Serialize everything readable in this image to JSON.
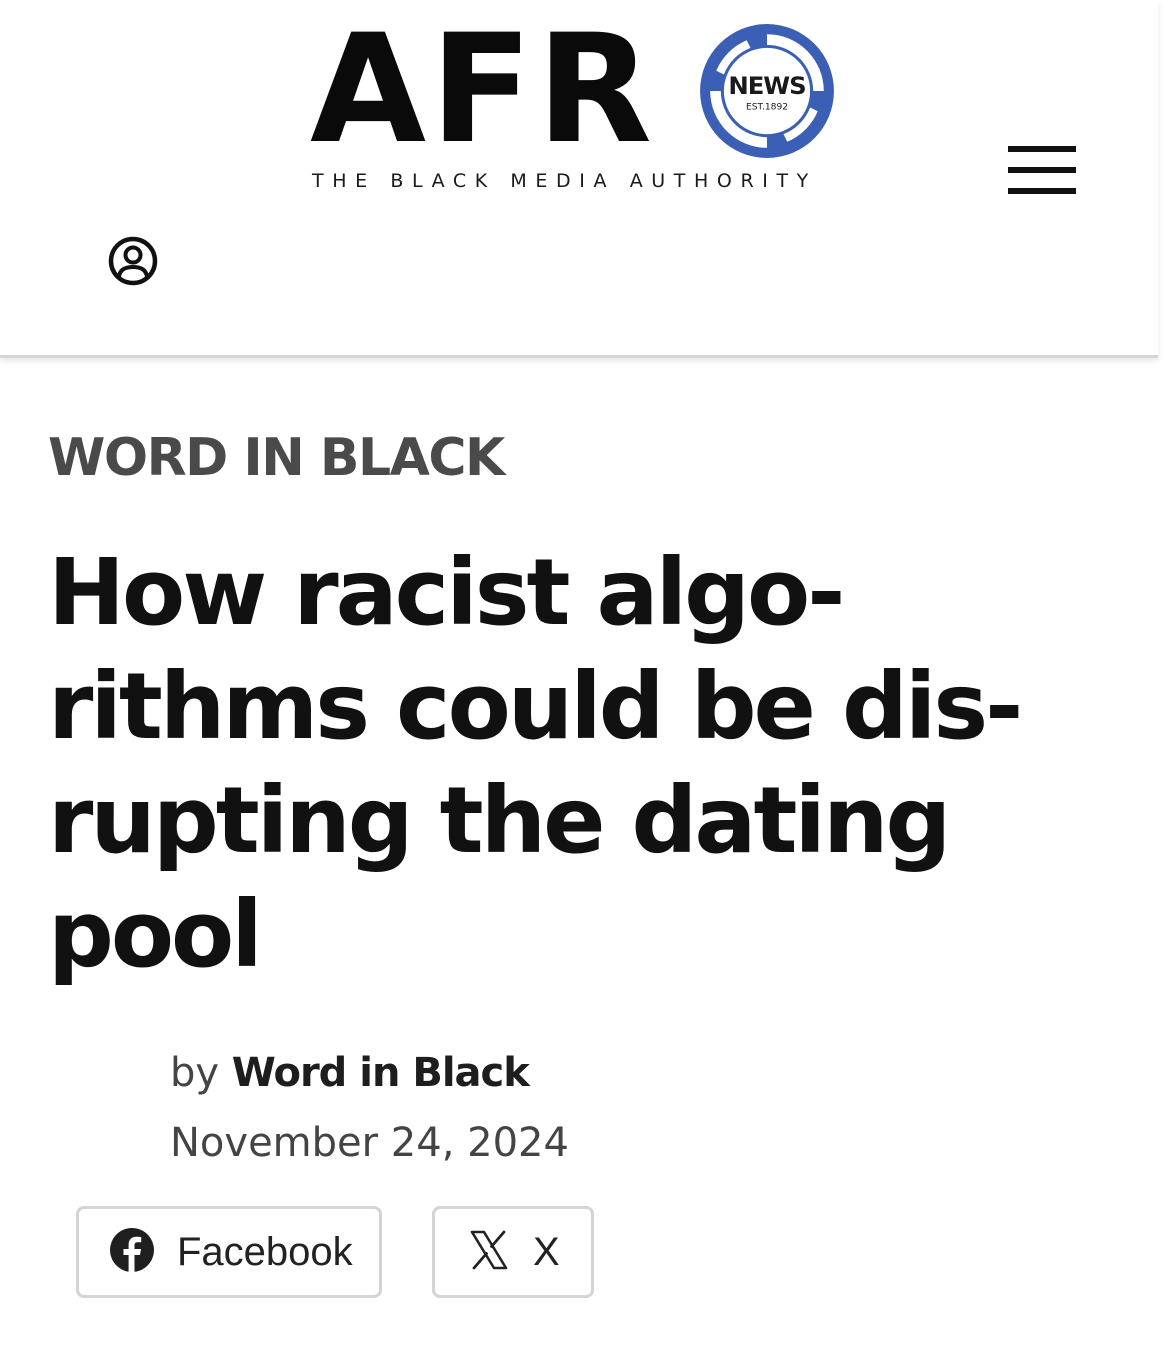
{
  "header": {
    "logo": {
      "letters": "AFR",
      "badge_text": "NEWS",
      "badge_est": "EST.1892",
      "tagline": "THE BLACK MEDIA AUTHORITY",
      "accent_color": "#3a5fb4"
    },
    "menu_icon": "hamburger-menu-icon",
    "account_icon": "user-account-icon"
  },
  "article": {
    "category": "WORD IN BLACK",
    "headline_lines": [
      "How racist algo-",
      "rithms could be dis-",
      "rupting the dating",
      "pool"
    ],
    "byline_prefix": "by",
    "author": "Word in Black",
    "date": "November 24, 2024"
  },
  "share": {
    "facebook_label": "Facebook",
    "facebook_icon": "facebook-icon",
    "x_label": "X",
    "x_icon": "x-logo-icon"
  }
}
